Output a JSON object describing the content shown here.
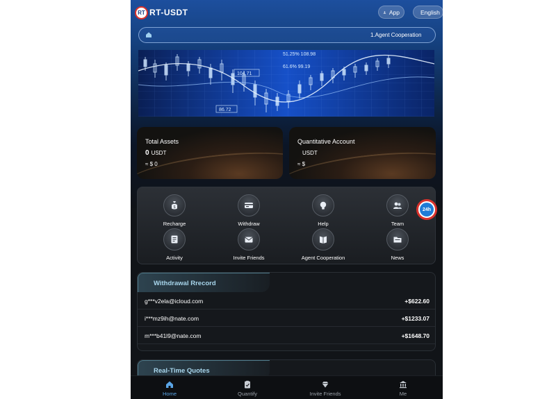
{
  "header": {
    "logo_text": "RT",
    "brand": "RT-USDT",
    "app_label": "App",
    "lang_label": "English"
  },
  "notice": {
    "text": "1.Agent Cooperation"
  },
  "banner": {
    "labels": [
      "51.25% 108.98",
      "61.6% 99.19",
      "104.71",
      "86.72"
    ]
  },
  "assets": {
    "total": {
      "title": "Total Assets",
      "amount": "0",
      "unit": "USDT",
      "approx": "≈ $ 0"
    },
    "quant": {
      "title": "Quantitative Account",
      "amount": "",
      "unit": "USDT",
      "approx": "≈ $"
    }
  },
  "menu": {
    "items": [
      {
        "label": "Recharge",
        "icon": "money-bag-icon"
      },
      {
        "label": "Withdraw",
        "icon": "card-icon"
      },
      {
        "label": "Help",
        "icon": "lightbulb-icon"
      },
      {
        "label": "Team",
        "icon": "team-icon"
      },
      {
        "label": "Activity",
        "icon": "document-icon"
      },
      {
        "label": "Invite Friends",
        "icon": "envelope-icon"
      },
      {
        "label": "Agent Cooperation",
        "icon": "book-icon"
      },
      {
        "label": "News",
        "icon": "folder-icon"
      }
    ]
  },
  "service": {
    "label": "24h"
  },
  "withdrawal": {
    "title": "Withdrawal Rrecord",
    "rows": [
      {
        "email": "g***v2ela@icloud.com",
        "amount": "+$622.60"
      },
      {
        "email": "i***mz9ih@nate.com",
        "amount": "+$1233.07"
      },
      {
        "email": "m***b41l9@nate.com",
        "amount": "+$1648.70"
      }
    ]
  },
  "quotes": {
    "title": "Real-Time Quotes"
  },
  "nav": {
    "items": [
      {
        "label": "Home",
        "active": true
      },
      {
        "label": "Quantify",
        "active": false
      },
      {
        "label": "Invite Friends",
        "active": false
      },
      {
        "label": "Me",
        "active": false
      }
    ]
  },
  "colors": {
    "accent": "#5aa5e6",
    "header_blue": "#1d4f9e",
    "brand_red": "#d9312b"
  }
}
